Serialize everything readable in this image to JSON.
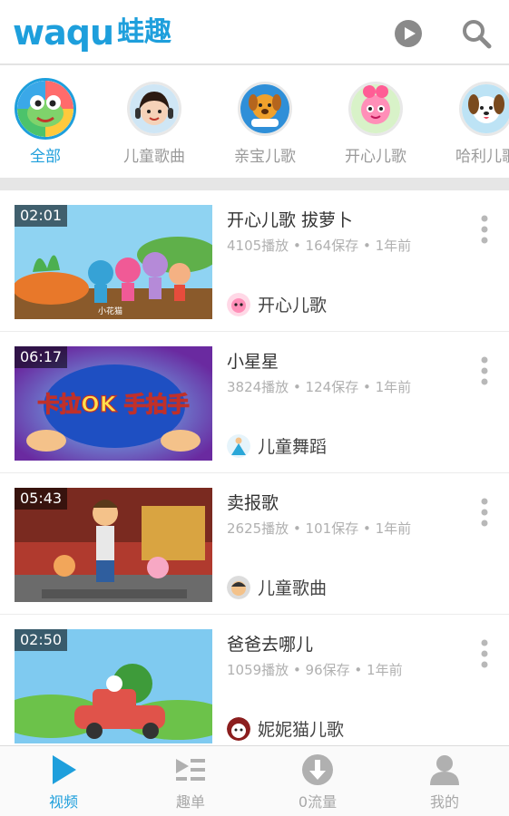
{
  "header": {
    "logo_latin": "waqu",
    "logo_cn": "蛙趣",
    "play_icon": "play-circle-icon",
    "search_icon": "search-icon"
  },
  "categories": [
    {
      "label": "全部",
      "selected": true
    },
    {
      "label": "儿童歌曲",
      "selected": false
    },
    {
      "label": "亲宝儿歌",
      "selected": false
    },
    {
      "label": "开心儿歌",
      "selected": false
    },
    {
      "label": "哈利儿歌",
      "selected": false
    }
  ],
  "videos": [
    {
      "duration": "02:01",
      "title": "开心儿歌 拔萝卜",
      "meta": "4105播放 • 164保存 • 1年前",
      "channel": "开心儿歌",
      "thumb_caption": "小花猫"
    },
    {
      "duration": "06:17",
      "title": "小星星",
      "meta": "3824播放 • 124保存 • 1年前",
      "channel": "儿童舞蹈",
      "thumb_caption": "卡拉OK 手拍手"
    },
    {
      "duration": "05:43",
      "title": "卖报歌",
      "meta": "2625播放 • 101保存 • 1年前",
      "channel": "儿童歌曲",
      "thumb_caption": ""
    },
    {
      "duration": "02:50",
      "title": "爸爸去哪儿",
      "meta": "1059播放 • 96保存 • 1年前",
      "channel": "妮妮猫儿歌",
      "thumb_caption": ""
    }
  ],
  "bottom_nav": [
    {
      "label": "视频",
      "icon": "play-icon",
      "active": true
    },
    {
      "label": "趣单",
      "icon": "playlist-icon",
      "active": false
    },
    {
      "label": "0流量",
      "icon": "download-icon",
      "active": false
    },
    {
      "label": "我的",
      "icon": "person-icon",
      "active": false
    }
  ],
  "colors": {
    "accent": "#1e9fdc",
    "muted": "#b0b0b0"
  }
}
